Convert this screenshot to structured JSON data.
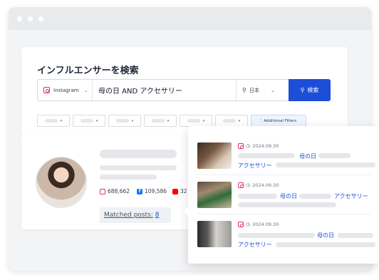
{
  "search": {
    "title": "インフルエンサーを検索",
    "platform": "Instagram",
    "query": "母の日 AND アクセサリー",
    "region": "日本",
    "search_button": "検索",
    "additional_filters": "Additional Filters"
  },
  "profile": {
    "followers_instagram": "688,662",
    "followers_facebook": "109,586",
    "followers_youtube": "32",
    "matched_label": "Matched posts:",
    "matched_count": "8"
  },
  "posts": [
    {
      "date": "2024.09.30",
      "keywords": [
        "母の日",
        "アクセサリー"
      ]
    },
    {
      "date": "2024.09.30",
      "keywords": [
        "母の日",
        "アクセサリー"
      ]
    },
    {
      "date": "2024.09.30",
      "keywords": [
        "母の日",
        "アクセサリー"
      ]
    }
  ],
  "colors": {
    "accent": "#1d4ed8",
    "instagram": "#e1306c",
    "facebook": "#1877f2",
    "youtube": "#ff0000"
  }
}
